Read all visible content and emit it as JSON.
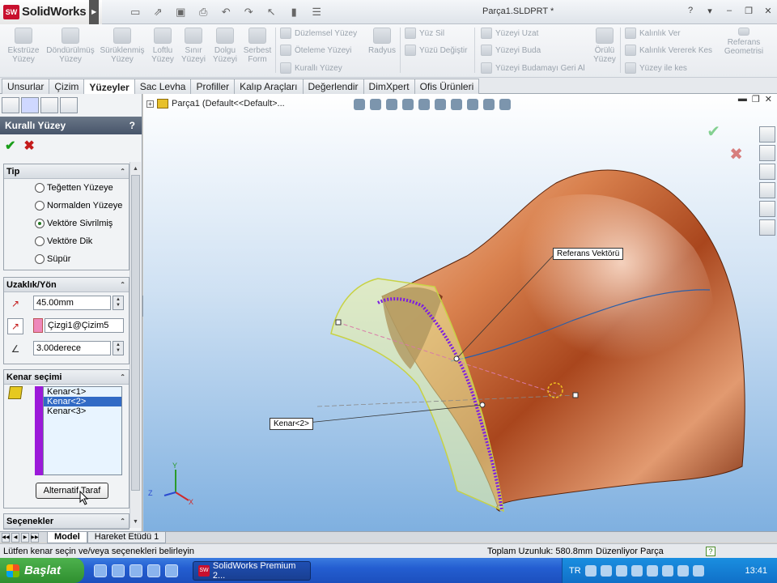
{
  "app": {
    "logo_box": "SW",
    "logo_text": "SolidWorks",
    "document_title": "Parça1.SLDPRT *"
  },
  "ribbon": {
    "buttons": [
      {
        "label": "Ekstrüze\nYüzey"
      },
      {
        "label": "Döndürülmüş\nYüzey"
      },
      {
        "label": "Sürüklenmiş\nYüzey"
      },
      {
        "label": "Loftlu\nYüzey"
      },
      {
        "label": "Sınır\nYüzeyi"
      },
      {
        "label": "Dolgu\nYüzeyi"
      },
      {
        "label": "Serbest\nForm"
      }
    ],
    "col1": [
      "Düzlemsel Yüzey",
      "Öteleme Yüzeyi",
      "Kurallı Yüzey"
    ],
    "radius": "Radyus",
    "col2": [
      "Yüz Sil",
      "Yüzü Değiştir"
    ],
    "col3": [
      "Yüzeyi Uzat",
      "Yüzeyi Buda",
      "Yüzeyi Budamayı Geri Al"
    ],
    "knit": "Örülü\nYüzey",
    "col4": [
      "Kalınlık Ver",
      "Kalınlık Vererek Kes",
      "Yüzey ile kes"
    ],
    "ref_geom": "Referans\nGeometrisi"
  },
  "tabs": [
    "Unsurlar",
    "Çizim",
    "Yüzeyler",
    "Sac Levha",
    "Profiller",
    "Kalıp Araçları",
    "Değerlendir",
    "DimXpert",
    "Ofis Ürünleri"
  ],
  "active_tab": "Yüzeyler",
  "property_manager": {
    "title": "Kurallı Yüzey",
    "help": "?",
    "ok": "✔",
    "cancel": "✖",
    "type_group": {
      "title": "Tip",
      "options": [
        "Teğetten Yüzeye",
        "Normalden Yüzeye",
        "Vektöre Sivrilmiş",
        "Vektöre Dik",
        "Süpür"
      ],
      "selected_index": 2
    },
    "distance_group": {
      "title": "Uzaklık/Yön",
      "distance": "45.00mm",
      "reference": "Çizgi1@Çizim5",
      "angle": "3.00derece"
    },
    "edge_group": {
      "title": "Kenar seçimi",
      "items": [
        "Kenar<1>",
        "Kenar<2>",
        "Kenar<3>"
      ],
      "selected_index": 1,
      "alt_button": "Alternatif Taraf"
    },
    "options_group": {
      "title": "Seçenekler"
    }
  },
  "viewport": {
    "tree_label": "Parça1  (Default<<Default>...",
    "callouts": {
      "ref_vector": "Referans Vektörü",
      "edge": "Kenar<2>"
    },
    "axes": {
      "x": "X",
      "y": "Y",
      "z": "Z"
    }
  },
  "bottom_tabs": [
    "Model",
    "Hareket Etüdü 1"
  ],
  "status": {
    "message": "Lütfen kenar seçin ve/veya seçenekleri belirleyin",
    "length": "Toplam Uzunluk: 580.8mm",
    "mode": "Düzenliyor Parça",
    "help": "?"
  },
  "taskbar": {
    "start": "Başlat",
    "task": "SolidWorks Premium 2...",
    "lang": "TR",
    "time": "13:41"
  }
}
